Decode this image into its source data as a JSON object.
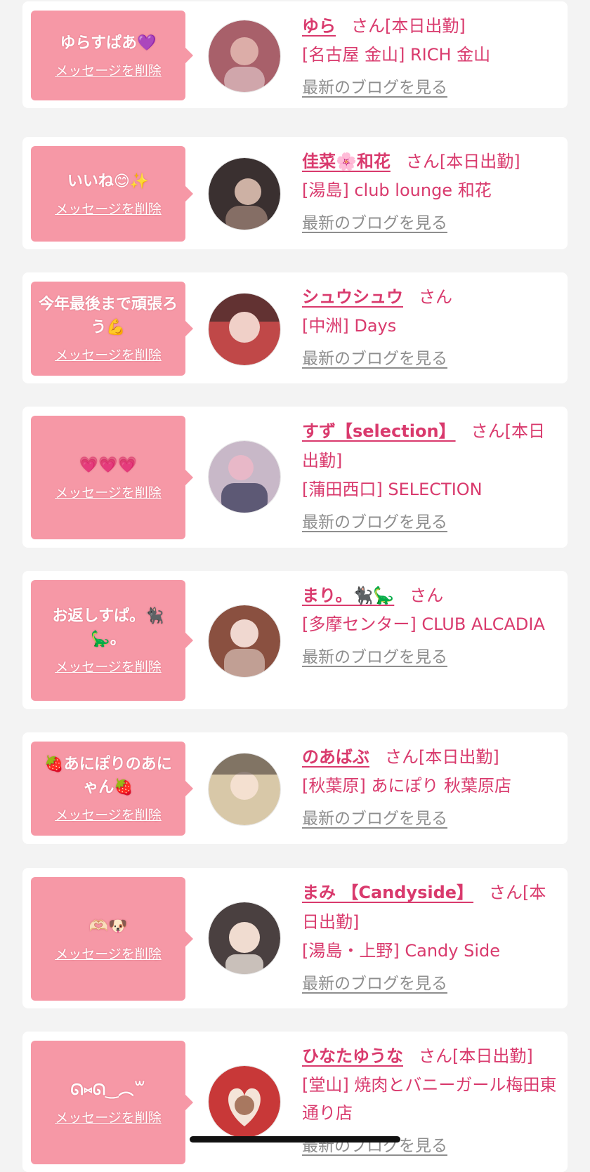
{
  "delete_label": "メッセージを削除",
  "blog_label": "最新のブログを見る",
  "honorific": "さん",
  "items": [
    {
      "message": "ゆらすぱあ💜",
      "name": "ゆら",
      "status": "[本日出勤]",
      "shop": "[名古屋 金山] RICH 金山",
      "avatar_color": "#a8606a"
    },
    {
      "message": "いいね😊✨",
      "name": "佳菜🌸和花",
      "status": "[本日出勤]",
      "shop": "[湯島] club lounge 和花",
      "avatar_color": "#3a3030"
    },
    {
      "message": "今年最後まで頑張ろう💪",
      "name": "シュウシュウ",
      "status": "",
      "shop": "[中洲] Days",
      "avatar_color": "#c04848"
    },
    {
      "message": "💗💗💗",
      "name": "すず【selection】",
      "status": "[本日出勤]",
      "shop": "[蒲田西口] SELECTION",
      "avatar_color": "#c8b8c8"
    },
    {
      "message": "お返しすぱ。🐈‍⬛🦕。",
      "name": "まり。🐈‍⬛🦕",
      "status": "",
      "shop": "[多摩センター] CLUB ALCADIA",
      "avatar_color": "#8a5040"
    },
    {
      "message": "🍓あにぽりのあにゃん🍓",
      "name": "のあばぶ",
      "status": "[本日出勤]",
      "shop": "[秋葉原] あにぽり 秋葉原店",
      "avatar_color": "#d8c8a8"
    },
    {
      "message": "🫶🏻🐶",
      "name": "まみ 【Candyside】",
      "status": "[本日出勤]",
      "shop": "[湯島・上野] Candy Side",
      "avatar_color": "#4a4040"
    },
    {
      "message": "ᘏ⑅ᘏ‿︵꒳",
      "name": "ひなたゆうな",
      "status": "[本日出勤]",
      "shop": "[堂山] 焼肉とバニーガール梅田東通り店",
      "avatar_color": "#c83838"
    }
  ]
}
